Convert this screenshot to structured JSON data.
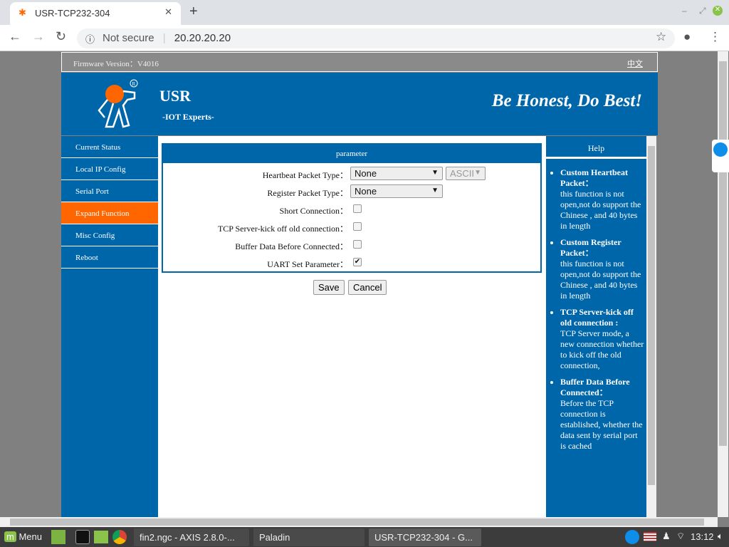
{
  "browser": {
    "tab_title": "USR-TCP232-304",
    "security": "Not secure",
    "url": "20.20.20.20"
  },
  "top": {
    "firmware": "Firmware Version：V4016",
    "lang": "中文"
  },
  "header": {
    "brand": "USR",
    "sub": "-IOT Experts-",
    "slogan": "Be Honest, Do Best!",
    "accent": "#ff6600",
    "blue": "#0066aa"
  },
  "sidebar": {
    "items": [
      {
        "label": "Current Status"
      },
      {
        "label": "Local IP Config"
      },
      {
        "label": "Serial Port"
      },
      {
        "label": "Expand Function",
        "active": true
      },
      {
        "label": "Misc Config"
      },
      {
        "label": "Reboot"
      }
    ]
  },
  "panel": {
    "title": "parameter",
    "heartbeat": {
      "label": "Heartbeat Packet Type：",
      "value": "None",
      "format": "ASCII"
    },
    "register": {
      "label": "Register Packet Type：",
      "value": "None"
    },
    "short": {
      "label": "Short Connection：",
      "checked": false
    },
    "kick": {
      "label": "TCP Server-kick off old connection：",
      "checked": false
    },
    "buffer": {
      "label": "Buffer Data Before Connected：",
      "checked": false
    },
    "uart": {
      "label": "UART Set Parameter：",
      "checked": true,
      "mark": "✔"
    },
    "save": "Save",
    "cancel": "Cancel"
  },
  "help": {
    "title": "Help",
    "items": [
      {
        "title": "Custom Heartbeat Packet：",
        "text": "this function is not open,not do support the Chinese , and 40 bytes in length"
      },
      {
        "title": "Custom Register Packet：",
        "text": "this function is not open,not do support the Chinese , and 40 bytes in length"
      },
      {
        "title": "TCP Server-kick off old connection :",
        "text": "TCP Server mode, a new connection whether to kick off the old connection,"
      },
      {
        "title": "Buffer Data Before Connected：",
        "text": "Before the TCP connection is established, whether the data sent by serial port is cached"
      }
    ]
  },
  "taskbar": {
    "menu": "Menu",
    "tasks": [
      "fin2.ngc - AXIS 2.8.0-...",
      "Paladin",
      "USR-TCP232-304 - G..."
    ],
    "clock": "13:12"
  }
}
